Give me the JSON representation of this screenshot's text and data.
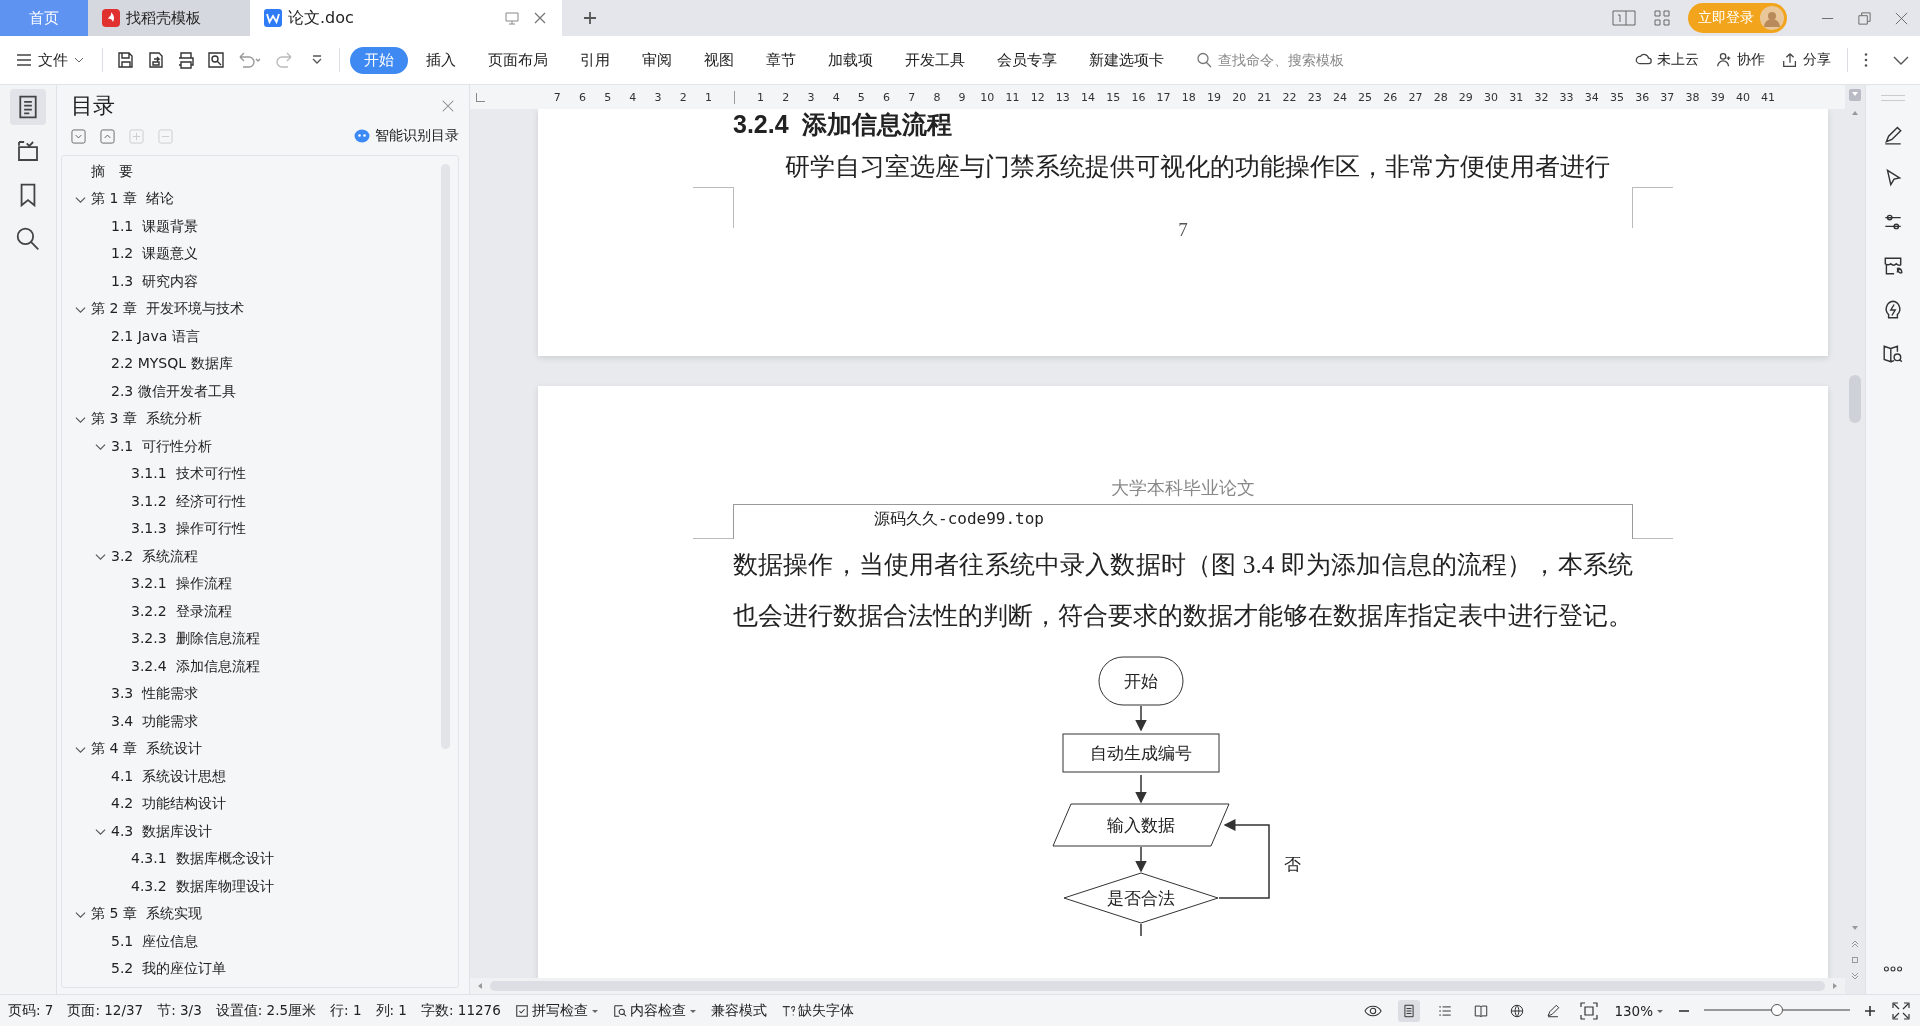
{
  "title_bar": {
    "tabs": [
      {
        "kind": "home",
        "label": "首页",
        "selected": false
      },
      {
        "kind": "template",
        "label": "找稻壳模板",
        "selected": false
      },
      {
        "kind": "document",
        "label": "论文.doc",
        "selected": true
      }
    ],
    "login_button": "立即登录"
  },
  "toolbar": {
    "file_menu": "文件",
    "ribbon_tabs": [
      {
        "label": "开始",
        "selected": true
      },
      {
        "label": "插入",
        "selected": false
      },
      {
        "label": "页面布局",
        "selected": false
      },
      {
        "label": "引用",
        "selected": false
      },
      {
        "label": "审阅",
        "selected": false
      },
      {
        "label": "视图",
        "selected": false
      },
      {
        "label": "章节",
        "selected": false
      },
      {
        "label": "加载项",
        "selected": false
      },
      {
        "label": "开发工具",
        "selected": false
      },
      {
        "label": "会员专享",
        "selected": false
      },
      {
        "label": "新建选项卡",
        "selected": false
      }
    ],
    "search": {
      "placeholder": "查找命令、搜索模板"
    },
    "actions": [
      {
        "kind": "cloud",
        "label": "未上云"
      },
      {
        "kind": "collab",
        "label": "协作"
      },
      {
        "kind": "share",
        "label": "分享"
      }
    ]
  },
  "ruler": {
    "left_ticks": [
      "7",
      "6",
      "5",
      "4",
      "3",
      "2",
      "1"
    ],
    "right_ticks": [
      "1",
      "2",
      "3",
      "4",
      "5",
      "6",
      "7",
      "8",
      "9",
      "10",
      "11",
      "12",
      "13",
      "14",
      "15",
      "16",
      "17",
      "18",
      "19",
      "20",
      "21",
      "22",
      "23",
      "24",
      "25",
      "26",
      "27",
      "28",
      "29",
      "30",
      "31",
      "32",
      "33",
      "34",
      "35",
      "36",
      "37",
      "38",
      "39",
      "40",
      "41"
    ]
  },
  "sidebar": {
    "title": "目录",
    "smart_button": "智能识别目录",
    "toc": [
      {
        "label": "摘　要"
      },
      {
        "label": "第 1 章  绪论",
        "expanded": true,
        "children": [
          {
            "label": "1.1  课题背景"
          },
          {
            "label": "1.2  课题意义"
          },
          {
            "label": "1.3  研究内容"
          }
        ]
      },
      {
        "label": "第 2 章  开发环境与技术",
        "expanded": true,
        "children": [
          {
            "label": "2.1 Java 语言"
          },
          {
            "label": "2.2 MYSQL 数据库"
          },
          {
            "label": "2.3 微信开发者工具"
          }
        ]
      },
      {
        "label": "第 3 章  系统分析",
        "expanded": true,
        "children": [
          {
            "label": "3.1  可行性分析",
            "expanded": true,
            "children": [
              {
                "label": "3.1.1  技术可行性"
              },
              {
                "label": "3.1.2  经济可行性"
              },
              {
                "label": "3.1.3  操作可行性"
              }
            ]
          },
          {
            "label": "3.2  系统流程",
            "expanded": true,
            "children": [
              {
                "label": "3.2.1  操作流程"
              },
              {
                "label": "3.2.2  登录流程"
              },
              {
                "label": "3.2.3  删除信息流程"
              },
              {
                "label": "3.2.4  添加信息流程"
              }
            ]
          },
          {
            "label": "3.3  性能需求"
          },
          {
            "label": "3.4  功能需求"
          }
        ]
      },
      {
        "label": "第 4 章  系统设计",
        "expanded": true,
        "children": [
          {
            "label": "4.1  系统设计思想"
          },
          {
            "label": "4.2  功能结构设计"
          },
          {
            "label": "4.3  数据库设计",
            "expanded": true,
            "children": [
              {
                "label": "4.3.1  数据库概念设计"
              },
              {
                "label": "4.3.2  数据库物理设计"
              }
            ]
          }
        ]
      },
      {
        "label": "第 5 章  系统实现",
        "expanded": true,
        "children": [
          {
            "label": "5.1  座位信息"
          },
          {
            "label": "5.2  我的座位订单"
          }
        ]
      }
    ]
  },
  "document": {
    "page_1": {
      "heading": "3.2.4  添加信息流程",
      "paragraph": "研学自习室选座与门禁系统提供可视化的功能操作区，非常方便使用者进行",
      "page_number": "7"
    },
    "page_2": {
      "header": "大学本科毕业论文",
      "watermark_text": "源码久久-code99.top",
      "paragraph": "数据操作，当使用者往系统中录入数据时（图 3.4 即为添加信息的流程），本系统也会进行数据合法性的判断，符合要求的数据才能够在数据库指定表中进行登记。",
      "flowchart": {
        "nodes": [
          {
            "kind": "terminal",
            "label": "开始"
          },
          {
            "kind": "process",
            "label": "自动生成编号"
          },
          {
            "kind": "input",
            "label": "输入数据"
          },
          {
            "kind": "decision",
            "label": "是否合法"
          }
        ],
        "loop_label": "否"
      }
    }
  },
  "status_bar": {
    "items": [
      {
        "kind": "plain",
        "label": "页码: 7"
      },
      {
        "kind": "plain",
        "label": "页面: 12/37"
      },
      {
        "kind": "plain",
        "label": "节: 3/3"
      },
      {
        "kind": "plain",
        "label": "设置值: 2.5厘米"
      },
      {
        "kind": "plain",
        "label": "行: 1"
      },
      {
        "kind": "plain",
        "label": "列: 1"
      },
      {
        "kind": "plain",
        "label": "字数: 11276"
      },
      {
        "kind": "spell",
        "label": "拼写检查"
      },
      {
        "kind": "content",
        "label": "内容检查"
      },
      {
        "kind": "plain",
        "label": "兼容模式"
      },
      {
        "kind": "font",
        "label": "缺失字体"
      }
    ],
    "view_modes": [
      {
        "kind": "page",
        "selected": true
      },
      {
        "kind": "outline",
        "selected": false
      },
      {
        "kind": "read",
        "selected": false
      },
      {
        "kind": "web",
        "selected": false
      },
      {
        "kind": "write",
        "selected": false
      }
    ],
    "zoom": {
      "label": "130%",
      "level": 0.5
    }
  }
}
